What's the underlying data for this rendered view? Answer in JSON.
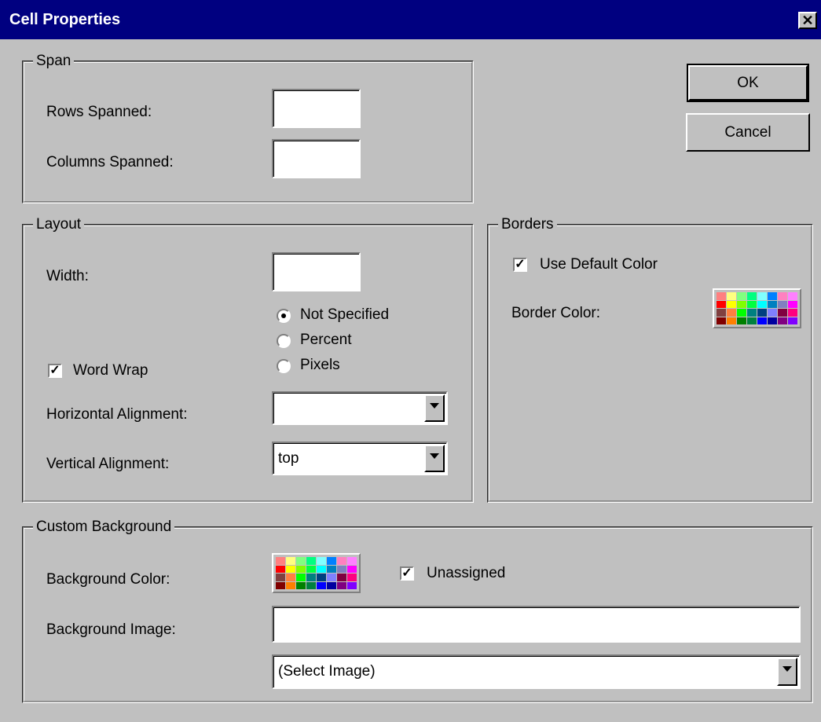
{
  "window": {
    "title": "Cell Properties",
    "close_glyph": "✕"
  },
  "buttons": {
    "ok": "OK",
    "cancel": "Cancel"
  },
  "span": {
    "legend": "Span",
    "rows_label": "Rows Spanned:",
    "rows_value": "",
    "cols_label": "Columns Spanned:",
    "cols_value": ""
  },
  "layout": {
    "legend": "Layout",
    "width_label": "Width:",
    "width_value": "",
    "radios": [
      {
        "label": "Not Specified",
        "selected": true
      },
      {
        "label": "Percent",
        "selected": false
      },
      {
        "label": "Pixels",
        "selected": false
      }
    ],
    "word_wrap_label": "Word Wrap",
    "word_wrap_checked": true,
    "halign_label": "Horizontal Alignment:",
    "halign_value": "",
    "valign_label": "Vertical Alignment:",
    "valign_value": "top"
  },
  "borders": {
    "legend": "Borders",
    "use_default_label": "Use Default Color",
    "use_default_checked": true,
    "border_color_label": "Border Color:"
  },
  "custom_background": {
    "legend": "Custom Background",
    "bg_color_label": "Background Color:",
    "unassigned_label": "Unassigned",
    "unassigned_checked": true,
    "bg_image_label": "Background Image:",
    "bg_image_value": "",
    "select_image_value": "(Select Image)"
  },
  "palette_colors": [
    "#ff8080",
    "#ffff80",
    "#80ff80",
    "#00ff80",
    "#80ffff",
    "#0080ff",
    "#ff80c0",
    "#ff80ff",
    "#ff0000",
    "#ffff00",
    "#80ff00",
    "#00ff40",
    "#00ffff",
    "#0080c0",
    "#8080c0",
    "#ff00ff",
    "#804040",
    "#ff8040",
    "#00ff00",
    "#008080",
    "#004080",
    "#8080ff",
    "#800040",
    "#ff0080",
    "#800000",
    "#ff8000",
    "#008000",
    "#008040",
    "#0000ff",
    "#0000a0",
    "#800080",
    "#8000ff"
  ]
}
